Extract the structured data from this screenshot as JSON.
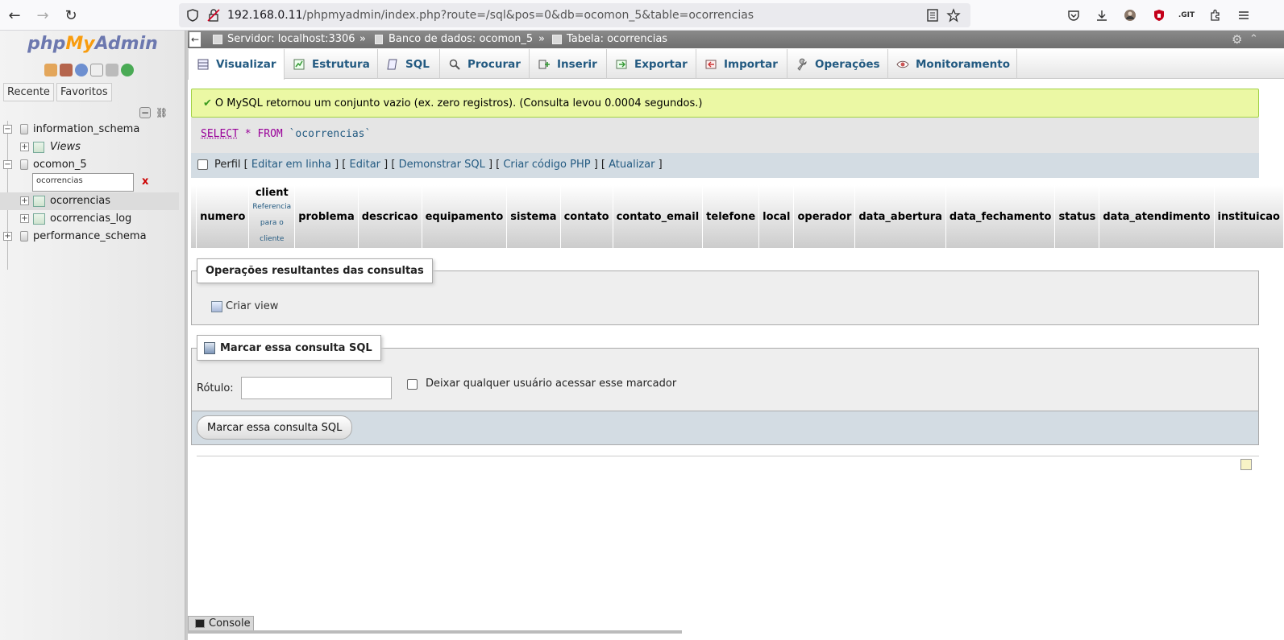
{
  "browser": {
    "url_host": "192.168.0.11",
    "url_path": "/phpmyadmin/index.php?route=/sql&pos=0&db=ocomon_5&table=ocorrencias",
    "git_badge": ".GIT"
  },
  "sidebar": {
    "logo_php": "php",
    "logo_my": "My",
    "logo_admin": "Admin",
    "tab_recent": "Recente",
    "tab_favorites": "Favoritos",
    "filter_value": "ocorrencias",
    "filter_clear": "x",
    "tree": [
      {
        "label": "information_schema"
      },
      {
        "label": "Views"
      },
      {
        "label": "ocomon_5"
      },
      {
        "label": "ocorrencias"
      },
      {
        "label": "ocorrencias_log"
      },
      {
        "label": "performance_schema"
      }
    ]
  },
  "breadcrumb": {
    "server": "Servidor: localhost:3306",
    "database": "Banco de dados: ocomon_5",
    "table": "Tabela: ocorrencias",
    "sep": "»"
  },
  "tabs": [
    {
      "label": "Visualizar"
    },
    {
      "label": "Estrutura"
    },
    {
      "label": "SQL"
    },
    {
      "label": "Procurar"
    },
    {
      "label": "Inserir"
    },
    {
      "label": "Exportar"
    },
    {
      "label": "Importar"
    },
    {
      "label": "Operações"
    },
    {
      "label": "Monitoramento"
    }
  ],
  "message": {
    "text": "O MySQL retornou um conjunto vazio (ex. zero registros). (Consulta levou 0.0004 segundos.)"
  },
  "sql": {
    "select": "SELECT",
    "star": "*",
    "from": "FROM",
    "table": "`ocorrencias`"
  },
  "query_tools": {
    "profile": "Perfil",
    "edit_inline": "Editar em linha",
    "edit": "Editar",
    "explain": "Demonstrar SQL",
    "php_code": "Criar código PHP",
    "refresh": "Atualizar"
  },
  "columns": [
    {
      "name": "numero"
    },
    {
      "name": "client",
      "sub": [
        "Referencia",
        "para o",
        "cliente"
      ]
    },
    {
      "name": "problema"
    },
    {
      "name": "descricao"
    },
    {
      "name": "equipamento"
    },
    {
      "name": "sistema"
    },
    {
      "name": "contato"
    },
    {
      "name": "contato_email"
    },
    {
      "name": "telefone"
    },
    {
      "name": "local"
    },
    {
      "name": "operador"
    },
    {
      "name": "data_abertura"
    },
    {
      "name": "data_fechamento"
    },
    {
      "name": "status"
    },
    {
      "name": "data_atendimento"
    },
    {
      "name": "instituicao"
    }
  ],
  "query_ops": {
    "legend": "Operações resultantes das consultas",
    "create_view": "Criar view"
  },
  "bookmark": {
    "legend": "Marcar essa consulta SQL",
    "label_text": "Rótulo:",
    "label_value": "",
    "share_text": "Deixar qualquer usuário acessar esse marcador",
    "submit": "Marcar essa consulta SQL"
  },
  "console": {
    "label": "Console"
  }
}
